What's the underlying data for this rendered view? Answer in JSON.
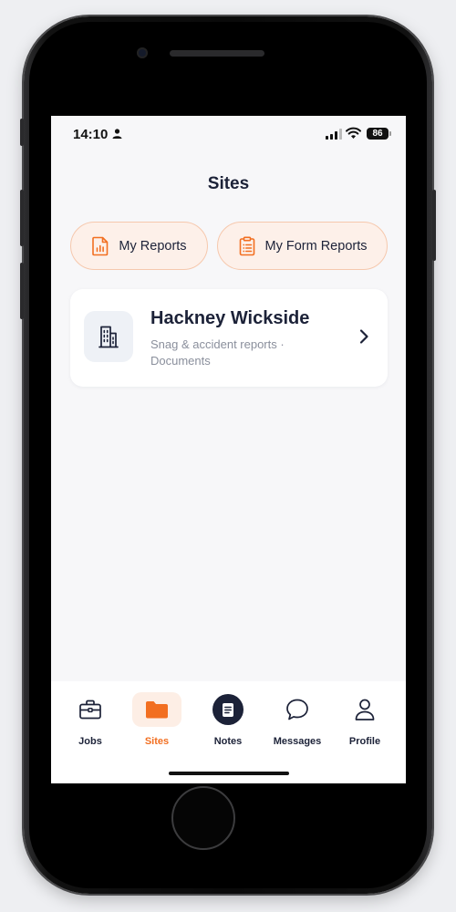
{
  "status_bar": {
    "time": "14:10",
    "battery": "86"
  },
  "header": {
    "title": "Sites"
  },
  "quick_actions": [
    {
      "label": "My Reports",
      "icon": "bar-chart-document-icon"
    },
    {
      "label": "My Form Reports",
      "icon": "clipboard-list-icon"
    }
  ],
  "sites": [
    {
      "name": "Hackney Wickside",
      "description": "Snag & accident reports · Documents",
      "icon": "building-icon"
    }
  ],
  "tab_bar": {
    "items": [
      {
        "label": "Jobs",
        "icon": "briefcase-icon",
        "active": false
      },
      {
        "label": "Sites",
        "icon": "folder-icon",
        "active": true
      },
      {
        "label": "Notes",
        "icon": "note-icon",
        "active": false
      },
      {
        "label": "Messages",
        "icon": "chat-bubble-icon",
        "active": false
      },
      {
        "label": "Profile",
        "icon": "person-icon",
        "active": false
      }
    ]
  },
  "colors": {
    "accent": "#f26f21",
    "navy": "#1c2238",
    "pill_bg": "#fdf0e9",
    "pill_border": "#f6c8ad",
    "muted_text": "#8a8f9c"
  }
}
